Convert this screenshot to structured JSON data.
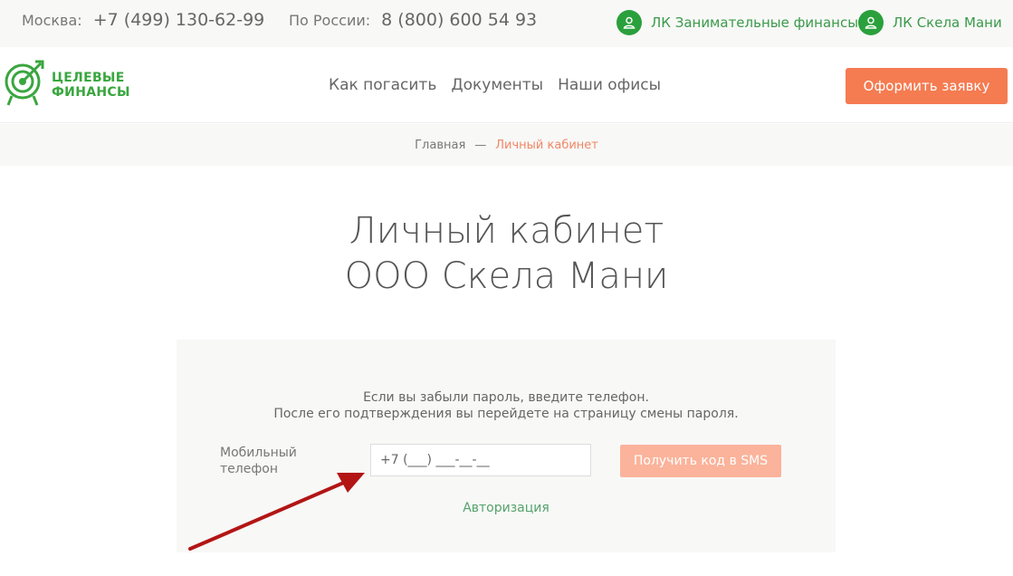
{
  "topbar": {
    "moscow_label": "Москва:",
    "moscow_phone": "+7 (499) 130-62-99",
    "russia_label": "По России:",
    "russia_phone": "8 (800) 600 54 93",
    "lk1_label": "ЛК Занимательные финансы",
    "lk2_label": "ЛК Скела Мани",
    "icon": "user-icon"
  },
  "header": {
    "logo_line1": "ЦЕЛЕВЫЕ",
    "logo_line2": "ФИНАНСЫ",
    "logo_icon": "target-arrow-icon",
    "nav": [
      "Как погасить",
      "Документы",
      "Наши офисы"
    ],
    "apply_label": "Оформить заявку"
  },
  "breadcrumb": {
    "home": "Главная",
    "separator": "—",
    "current": "Личный кабинет"
  },
  "title": {
    "line1": "Личный кабинет",
    "line2": "ООО Скела Мани"
  },
  "form": {
    "hint_line1": "Если вы забыли пароль, введите телефон.",
    "hint_line2": "После его подтверждения вы перейдете на страницу смены пароля.",
    "phone_label_line1": "Мобильный",
    "phone_label_line2": "телефон",
    "phone_value": "+7 (___) ___-__-__",
    "sms_button": "Получить код в SMS",
    "auth_link": "Авторизация"
  },
  "colors": {
    "brand_green": "#3aa63f",
    "accent_orange": "#f57b51",
    "sms_button": "#fbb39b",
    "annotation_arrow": "#b31515"
  }
}
